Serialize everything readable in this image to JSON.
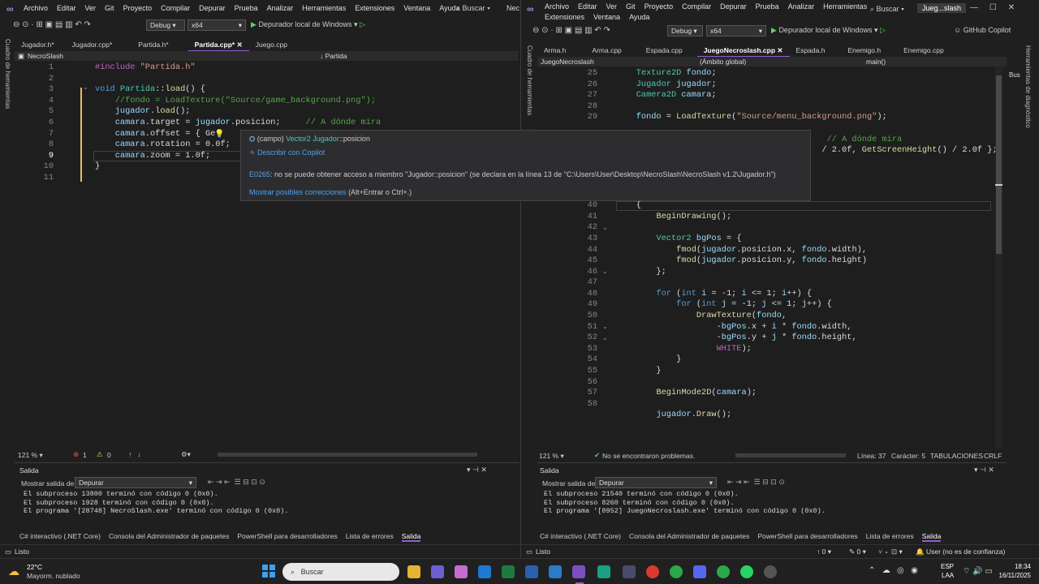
{
  "left": {
    "menu": [
      "Archivo",
      "Editar",
      "Ver",
      "Git",
      "Proyecto",
      "Compilar",
      "Depurar",
      "Prueba",
      "Analizar",
      "Herramientas",
      "Extensiones",
      "Ventana",
      "Ayuda"
    ],
    "search": "Buscar",
    "title_fragment": "Nec",
    "config": "Debug",
    "platform": "x64",
    "run_label": "Depurador local de Windows",
    "tabs": [
      "Jugador.h*",
      "Jugador.cpp*",
      "Partida.h*",
      "Partida.cpp*",
      "Juego.cpp"
    ],
    "active_tab_index": 3,
    "nav_project": "NecroSlash",
    "nav_member": "Partida",
    "side_label": "Cuadro de herramientas",
    "line_numbers": [
      "1",
      "2",
      "3",
      "4",
      "5",
      "6",
      "7",
      "8",
      "9",
      "10",
      "11"
    ],
    "code_lines": [
      "#include \"Partida.h\"",
      "",
      "void Partida::load() {",
      "    //fondo = LoadTexture(\"Source/game_background.png\");",
      "    jugador.load();",
      "    camara.target = jugador.posicion;     // A dónde mira",
      "    camara.offset = { Ge       e",
      "    camara.rotation = 0.0f;",
      "    camara.zoom = 1.0f;",
      "}",
      ""
    ],
    "zoom": "121 %",
    "errors": "1",
    "warnings": "0",
    "output_title": "Salida",
    "output_from_label": "Mostrar salida de:",
    "output_from": "Depurar",
    "output_lines": [
      "El subproceso 13800 terminó con código 0 (0x0).",
      "El subproceso 1928 terminó con código 0 (0x0).",
      "El programa '[28748] NecroSlash.exe' terminó con código 0 (0x0)."
    ],
    "bottom_tabs": [
      "C# interactivo (.NET Core)",
      "Consola del Administrador de paquetes",
      "PowerShell para desarrolladores",
      "Lista de errores",
      "Salida"
    ],
    "status": "Listo"
  },
  "tooltip": {
    "line1_prefix": "(campo)",
    "line1_type": "Vector2",
    "line1_member": "Jugador::posicion",
    "copilot": "Describir con Copilot",
    "error_code": "E0265",
    "error_text": ": no se puede obtener acceso a miembro \"Jugador::posicion\" (se declara en la línea 13 de \"C:\\Users\\User\\Desktop\\NecroSlash\\NecroSlash v1.2\\Jugador.h\")",
    "fix_link": "Mostrar posibles correcciones",
    "fix_shortcut": "(Alt+Entrar o Ctrl+.)"
  },
  "right": {
    "menu_row1": [
      "Archivo",
      "Editar",
      "Ver",
      "Git",
      "Proyecto",
      "Compilar",
      "Depurar",
      "Prueba",
      "Analizar",
      "Herramientas"
    ],
    "menu_row2": [
      "Extensiones",
      "Ventana",
      "Ayuda"
    ],
    "search": "Buscar",
    "title": "Jueg...slash",
    "config": "Debug",
    "platform": "x64",
    "run_label": "Depurador local de Windows",
    "copilot": "GitHub Copilot",
    "tabs": [
      "Arma.h",
      "Arma.cpp",
      "Espada.cpp",
      "JuegoNecroslash.cpp",
      "Espada.h",
      "Enemigo.h",
      "Enemigo.cpp"
    ],
    "active_tab_index": 3,
    "nav_project": "JuegoNecroslash",
    "nav_scope": "(Ámbito global)",
    "nav_member": "main()",
    "side_left": "Cuadro de herramientas",
    "side_right": "Herramientas de diagnóstico",
    "line_numbers": [
      "25",
      "26",
      "27",
      "28",
      "29",
      "",
      "",
      "",
      "",
      "37",
      "38",
      "39",
      "40",
      "41",
      "42",
      "43",
      "44",
      "45",
      "46",
      "47",
      "48",
      "49",
      "50",
      "51",
      "52",
      "53",
      "54",
      "55",
      "56",
      "57",
      "58"
    ],
    "code_lines": [
      "    Texture2D fondo;",
      "    Jugador jugador;",
      "    Camera2D camara;",
      "",
      "    fondo = LoadTexture(\"Source/menu_background.png\");",
      "",
      "                                          // A dónde mira",
      "                                         / 2.0f, GetScreenHeight() / 2.0f };",
      "",
      "",
      "",
      "    while (!WindowShouldClose())",
      "    {",
      "        BeginDrawing();",
      "",
      "        Vector2 bgPos = {",
      "            fmod(jugador.posicion.x, fondo.width),",
      "            fmod(jugador.posicion.y, fondo.height)",
      "        };",
      "",
      "        for (int i = -1; i <= 1; i++) {",
      "            for (int j = -1; j <= 1; j++) {",
      "                DrawTexture(fondo,",
      "                    -bgPos.x + i * fondo.width,",
      "                    -bgPos.y + j * fondo.height,",
      "                    WHITE);",
      "            }",
      "        }",
      "",
      "        BeginMode2D(camara);",
      "",
      "        jugador.Draw();"
    ],
    "zoom": "121 %",
    "no_problems": "No se encontraron problemas.",
    "line_col": "Línea: 37",
    "char": "Carácter: 5",
    "tabs_mode": "TABULACIONES",
    "eol": "CRLF",
    "output_title": "Salida",
    "output_from_label": "Mostrar salida de:",
    "output_from": "Depurar",
    "output_lines": [
      "El subproceso 21540 terminó con código 0 (0x0).",
      "El subproceso 8260 terminó con código 0 (0x0).",
      "El programa '[8952] JuegoNecroslash.exe' terminó con código 0 (0x0)."
    ],
    "bottom_tabs": [
      "C# interactivo (.NET Core)",
      "Consola del Administrador de paquetes",
      "PowerShell para desarrolladores",
      "Lista de errores",
      "Salida"
    ],
    "status": "Listo",
    "status_up": "0",
    "status_pen": "0",
    "status_branch": "",
    "user": "User (no es de confianza)"
  },
  "taskbar": {
    "temp": "22°C",
    "weather": "Mayorm. nublado",
    "search": "Buscar",
    "lang1": "ESP",
    "lang2": "LAA",
    "time": "18:34",
    "date": "16/11/2025"
  },
  "colors": {
    "accent": "#9b59d0",
    "error": "#f14c4c",
    "link": "#4aa3f0"
  }
}
